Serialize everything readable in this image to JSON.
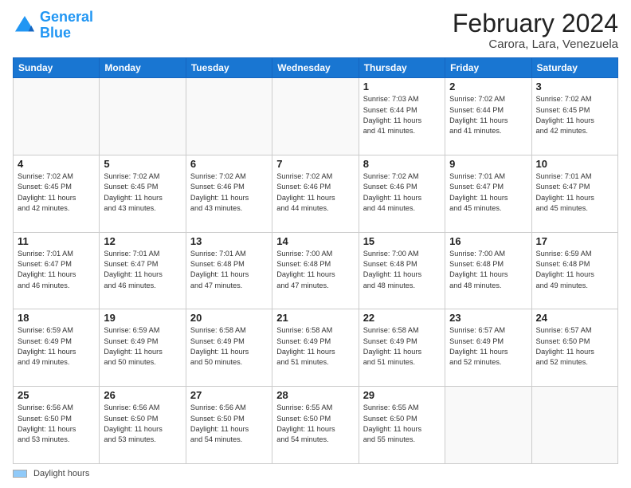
{
  "logo": {
    "line1": "General",
    "line2": "Blue"
  },
  "header": {
    "month_year": "February 2024",
    "location": "Carora, Lara, Venezuela"
  },
  "days_of_week": [
    "Sunday",
    "Monday",
    "Tuesday",
    "Wednesday",
    "Thursday",
    "Friday",
    "Saturday"
  ],
  "footer": {
    "swatch_label": "Daylight hours"
  },
  "weeks": [
    [
      {
        "day": "",
        "info": ""
      },
      {
        "day": "",
        "info": ""
      },
      {
        "day": "",
        "info": ""
      },
      {
        "day": "",
        "info": ""
      },
      {
        "day": "1",
        "info": "Sunrise: 7:03 AM\nSunset: 6:44 PM\nDaylight: 11 hours\nand 41 minutes."
      },
      {
        "day": "2",
        "info": "Sunrise: 7:02 AM\nSunset: 6:44 PM\nDaylight: 11 hours\nand 41 minutes."
      },
      {
        "day": "3",
        "info": "Sunrise: 7:02 AM\nSunset: 6:45 PM\nDaylight: 11 hours\nand 42 minutes."
      }
    ],
    [
      {
        "day": "4",
        "info": "Sunrise: 7:02 AM\nSunset: 6:45 PM\nDaylight: 11 hours\nand 42 minutes."
      },
      {
        "day": "5",
        "info": "Sunrise: 7:02 AM\nSunset: 6:45 PM\nDaylight: 11 hours\nand 43 minutes."
      },
      {
        "day": "6",
        "info": "Sunrise: 7:02 AM\nSunset: 6:46 PM\nDaylight: 11 hours\nand 43 minutes."
      },
      {
        "day": "7",
        "info": "Sunrise: 7:02 AM\nSunset: 6:46 PM\nDaylight: 11 hours\nand 44 minutes."
      },
      {
        "day": "8",
        "info": "Sunrise: 7:02 AM\nSunset: 6:46 PM\nDaylight: 11 hours\nand 44 minutes."
      },
      {
        "day": "9",
        "info": "Sunrise: 7:01 AM\nSunset: 6:47 PM\nDaylight: 11 hours\nand 45 minutes."
      },
      {
        "day": "10",
        "info": "Sunrise: 7:01 AM\nSunset: 6:47 PM\nDaylight: 11 hours\nand 45 minutes."
      }
    ],
    [
      {
        "day": "11",
        "info": "Sunrise: 7:01 AM\nSunset: 6:47 PM\nDaylight: 11 hours\nand 46 minutes."
      },
      {
        "day": "12",
        "info": "Sunrise: 7:01 AM\nSunset: 6:47 PM\nDaylight: 11 hours\nand 46 minutes."
      },
      {
        "day": "13",
        "info": "Sunrise: 7:01 AM\nSunset: 6:48 PM\nDaylight: 11 hours\nand 47 minutes."
      },
      {
        "day": "14",
        "info": "Sunrise: 7:00 AM\nSunset: 6:48 PM\nDaylight: 11 hours\nand 47 minutes."
      },
      {
        "day": "15",
        "info": "Sunrise: 7:00 AM\nSunset: 6:48 PM\nDaylight: 11 hours\nand 48 minutes."
      },
      {
        "day": "16",
        "info": "Sunrise: 7:00 AM\nSunset: 6:48 PM\nDaylight: 11 hours\nand 48 minutes."
      },
      {
        "day": "17",
        "info": "Sunrise: 6:59 AM\nSunset: 6:48 PM\nDaylight: 11 hours\nand 49 minutes."
      }
    ],
    [
      {
        "day": "18",
        "info": "Sunrise: 6:59 AM\nSunset: 6:49 PM\nDaylight: 11 hours\nand 49 minutes."
      },
      {
        "day": "19",
        "info": "Sunrise: 6:59 AM\nSunset: 6:49 PM\nDaylight: 11 hours\nand 50 minutes."
      },
      {
        "day": "20",
        "info": "Sunrise: 6:58 AM\nSunset: 6:49 PM\nDaylight: 11 hours\nand 50 minutes."
      },
      {
        "day": "21",
        "info": "Sunrise: 6:58 AM\nSunset: 6:49 PM\nDaylight: 11 hours\nand 51 minutes."
      },
      {
        "day": "22",
        "info": "Sunrise: 6:58 AM\nSunset: 6:49 PM\nDaylight: 11 hours\nand 51 minutes."
      },
      {
        "day": "23",
        "info": "Sunrise: 6:57 AM\nSunset: 6:49 PM\nDaylight: 11 hours\nand 52 minutes."
      },
      {
        "day": "24",
        "info": "Sunrise: 6:57 AM\nSunset: 6:50 PM\nDaylight: 11 hours\nand 52 minutes."
      }
    ],
    [
      {
        "day": "25",
        "info": "Sunrise: 6:56 AM\nSunset: 6:50 PM\nDaylight: 11 hours\nand 53 minutes."
      },
      {
        "day": "26",
        "info": "Sunrise: 6:56 AM\nSunset: 6:50 PM\nDaylight: 11 hours\nand 53 minutes."
      },
      {
        "day": "27",
        "info": "Sunrise: 6:56 AM\nSunset: 6:50 PM\nDaylight: 11 hours\nand 54 minutes."
      },
      {
        "day": "28",
        "info": "Sunrise: 6:55 AM\nSunset: 6:50 PM\nDaylight: 11 hours\nand 54 minutes."
      },
      {
        "day": "29",
        "info": "Sunrise: 6:55 AM\nSunset: 6:50 PM\nDaylight: 11 hours\nand 55 minutes."
      },
      {
        "day": "",
        "info": ""
      },
      {
        "day": "",
        "info": ""
      }
    ]
  ]
}
